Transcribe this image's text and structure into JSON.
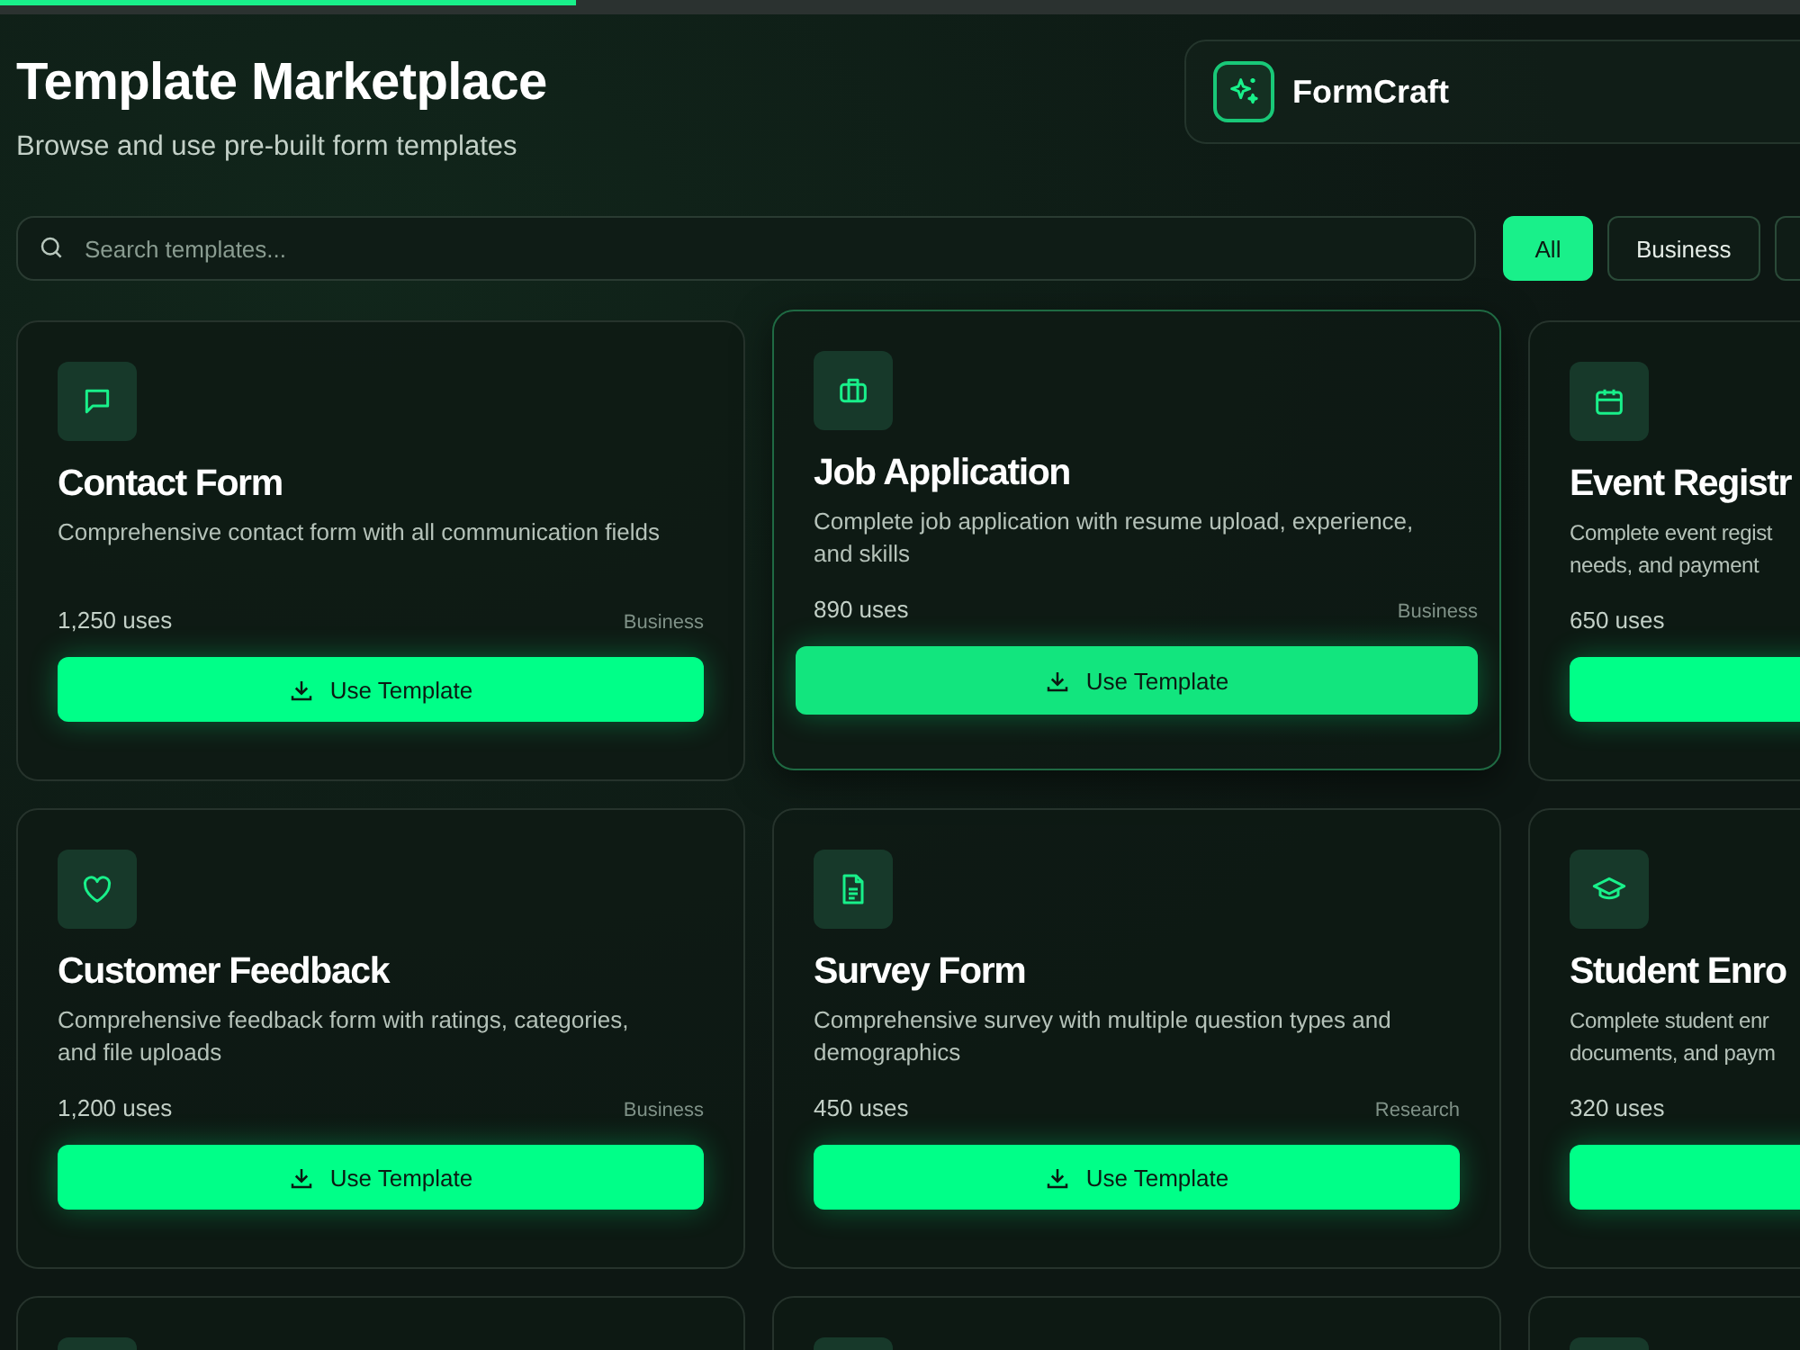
{
  "progress": {
    "level": 0.32
  },
  "header": {
    "title": "Template Marketplace",
    "subtitle": "Browse and use pre-built form templates"
  },
  "brand": {
    "name": "FormCraft"
  },
  "search": {
    "placeholder": "Search templates..."
  },
  "filters": [
    {
      "label": "All",
      "selected": true
    },
    {
      "label": "Business",
      "selected": false
    },
    {
      "selected": false
    }
  ],
  "templates": [
    {
      "kind": "full",
      "title": "Contact Form",
      "description": "Comprehensive contact form with all communication fields",
      "uses": "1,250 uses",
      "category": "Business",
      "button": "Use Template",
      "hovered": false
    },
    {
      "kind": "full",
      "title": "Job Application",
      "description": "Complete job application with resume upload, experience, and skills",
      "uses": "890 uses",
      "category": "Business",
      "button": "Use Template",
      "hovered": true
    },
    {
      "kind": "full",
      "title": "Event Registr",
      "description": "Complete event regist\nneeds, and payment",
      "uses": "650 uses",
      "hovered": false
    },
    {
      "kind": "full",
      "title": "Customer Feedback",
      "description": "Comprehensive feedback form with ratings, categories, and file uploads",
      "uses": "1,200 uses",
      "category": "Business",
      "button": "Use Template",
      "hovered": false
    },
    {
      "kind": "full",
      "title": "Survey Form",
      "description": "Comprehensive survey with multiple question types and demographics",
      "uses": "450 uses",
      "category": "Research",
      "button": "Use Template",
      "hovered": false
    },
    {
      "kind": "full",
      "title": "Student Enro",
      "description": "Complete student enr\ndocuments, and paym",
      "uses": "320 uses",
      "hovered": false
    },
    {
      "kind": "partial"
    },
    {
      "kind": "partial"
    },
    {
      "kind": "partial"
    }
  ]
}
